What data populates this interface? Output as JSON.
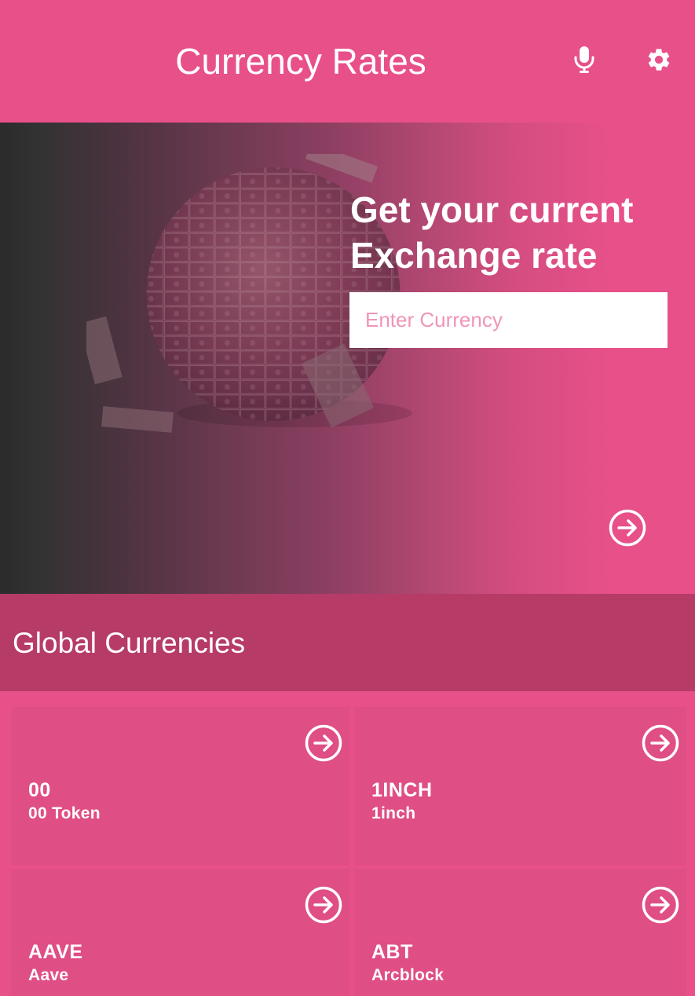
{
  "header": {
    "title": "Currency Rates",
    "mic_icon": "microphone-icon",
    "settings_icon": "gear-icon"
  },
  "hero": {
    "headline_line1": "Get your current",
    "headline_line2": "Exchange rate",
    "input_placeholder": "Enter Currency",
    "input_value": "",
    "go_icon": "arrow-right-circle-icon",
    "image": "money-globe-image"
  },
  "section": {
    "title": "Global Currencies"
  },
  "currencies": [
    {
      "code": "00",
      "name": "00 Token"
    },
    {
      "code": "1INCH",
      "name": "1inch"
    },
    {
      "code": "AAVE",
      "name": "Aave"
    },
    {
      "code": "ABT",
      "name": "Arcblock"
    }
  ],
  "colors": {
    "primary": "#e8508a",
    "section_bar": "#b63b67",
    "card": "#df4e84",
    "placeholder": "#f094b8"
  }
}
